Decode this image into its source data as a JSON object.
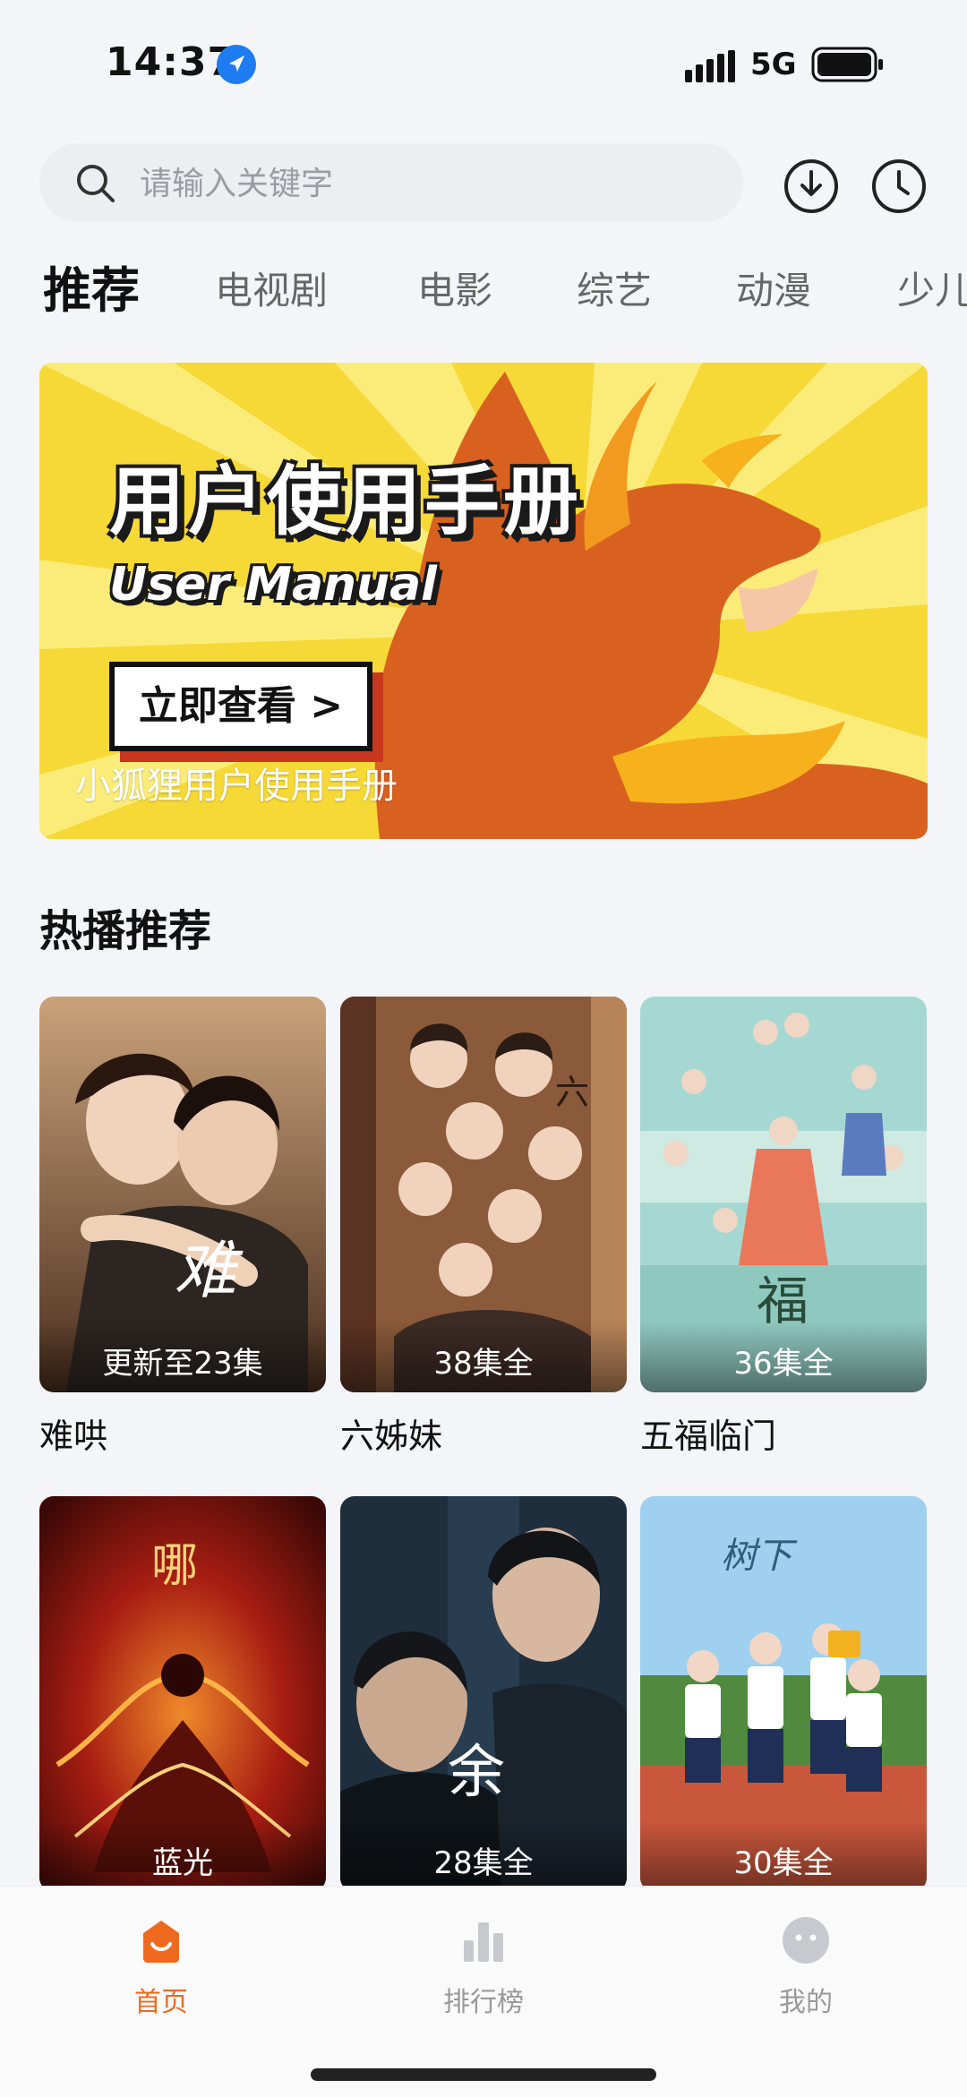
{
  "status_bar": {
    "time": "14:37",
    "network": "5G"
  },
  "search": {
    "placeholder": "请输入关键字"
  },
  "tabs": [
    "推荐",
    "电视剧",
    "电影",
    "综艺",
    "动漫",
    "少儿"
  ],
  "banner": {
    "title": "用户使用手册",
    "subtitle": "User Manual",
    "button_label": "立即查看 >",
    "caption": "小狐狸用户使用手册"
  },
  "section": {
    "title": "热播推荐"
  },
  "cards": [
    {
      "title": "难哄",
      "badge": "更新至23集"
    },
    {
      "title": "六姊妹",
      "badge": "38集全"
    },
    {
      "title": "五福临门",
      "badge": "36集全"
    },
    {
      "title": "",
      "badge": "蓝光"
    },
    {
      "title": "",
      "badge": "28集全"
    },
    {
      "title": "",
      "badge": "30集全"
    }
  ],
  "nav": [
    {
      "label": "首页",
      "icon": "home-icon",
      "active": true
    },
    {
      "label": "排行榜",
      "icon": "ranking-icon",
      "active": false
    },
    {
      "label": "我的",
      "icon": "profile-icon",
      "active": false
    }
  ],
  "colors": {
    "accent": "#ef6a1f",
    "banner_yellow": "#f7e24c",
    "page_bg": "#f4f5f8"
  }
}
